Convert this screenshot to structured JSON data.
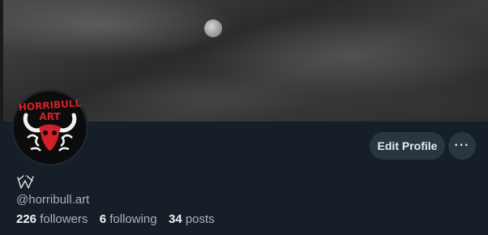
{
  "profile": {
    "handle": "@horribull.art",
    "avatar_logo_text": "HORRIBULL ART",
    "display_name_icon": "doodle-glyph-icon"
  },
  "actions": {
    "edit_profile_label": "Edit Profile",
    "more_label": "···"
  },
  "stats": {
    "followers_count": "226",
    "followers_label": "followers",
    "following_count": "6",
    "following_label": "following",
    "posts_count": "34",
    "posts_label": "posts"
  },
  "colors": {
    "background": "#161e27",
    "button_bg": "#2a3542",
    "logo_red": "#d3202a"
  }
}
